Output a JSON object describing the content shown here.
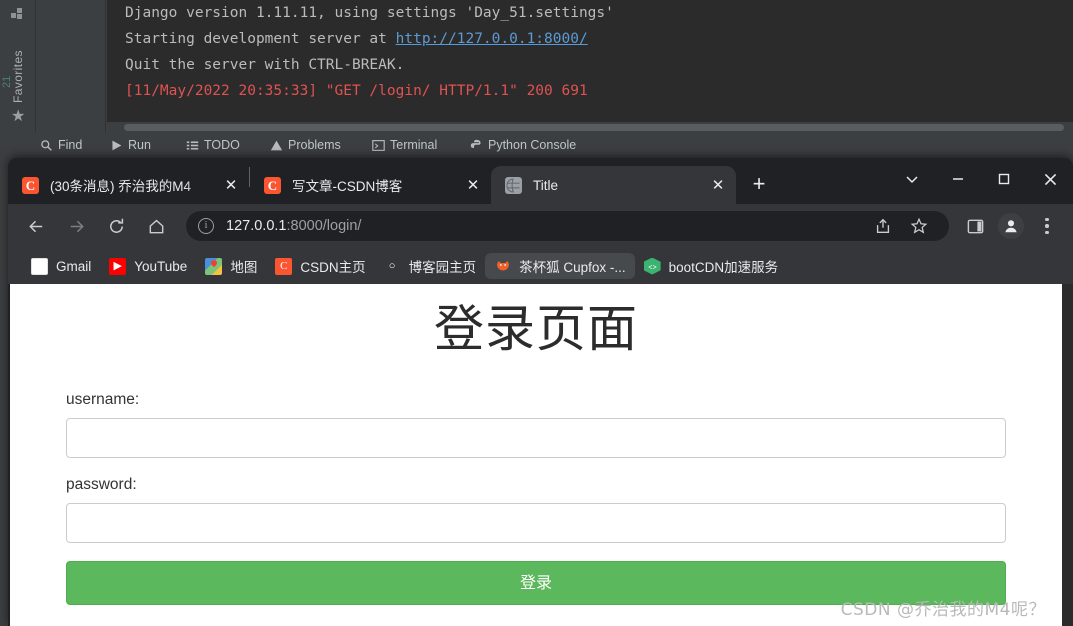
{
  "ide": {
    "sidebar": {
      "favorites_label": "Favorites",
      "star_icon": "star-icon",
      "gutter_number": "21"
    },
    "console_lines": [
      "Django version 1.11.11, using settings 'Day_51.settings'",
      "Starting development server at ",
      "Quit the server with CTRL-BREAK.",
      "[11/May/2022 20:35:33] \"GET /login/ HTTP/1.1\" 200 691"
    ],
    "console_link": "http://127.0.0.1:8000/",
    "toolwindows": [
      {
        "label": "Find",
        "icon": "search-icon"
      },
      {
        "label": "Run",
        "icon": "play-icon"
      },
      {
        "label": "TODO",
        "icon": "list-icon"
      },
      {
        "label": "Problems",
        "icon": "warning-icon"
      },
      {
        "label": "Terminal",
        "icon": "terminal-icon"
      },
      {
        "label": "Python Console",
        "icon": "python-icon"
      }
    ]
  },
  "browser": {
    "tabs": [
      {
        "title": "(30条消息) 乔治我的M4",
        "favicon": "csdn-icon",
        "favicon_text": "C",
        "active": false
      },
      {
        "title": "写文章-CSDN博客",
        "favicon": "csdn-icon",
        "favicon_text": "C",
        "active": false
      },
      {
        "title": "Title",
        "favicon": "globe-icon",
        "favicon_text": "⊕",
        "active": true
      }
    ],
    "tab_close_label": "✕",
    "new_tab_label": "+",
    "window_controls": [
      {
        "name": "tab-search-button",
        "glyph": "chevron-down-icon"
      },
      {
        "name": "minimize-button",
        "glyph": "minimize-icon"
      },
      {
        "name": "maximize-button",
        "glyph": "maximize-icon"
      },
      {
        "name": "close-window-button",
        "glyph": "close-icon"
      }
    ],
    "nav": {
      "back": "back-arrow-icon",
      "forward": "forward-arrow-icon",
      "reload": "reload-icon",
      "home": "home-icon"
    },
    "omnibox": {
      "info_glyph": "ⓘ",
      "url_host": "127.0.0.1",
      "url_path": ":8000/login/",
      "full_url": "127.0.0.1:8000/login/"
    },
    "toolbar_right": [
      {
        "name": "share-icon"
      },
      {
        "name": "bookmark-star-icon"
      },
      {
        "name": "side-panel-icon"
      },
      {
        "name": "profile-avatar"
      },
      {
        "name": "chrome-menu-icon"
      }
    ],
    "bookmarks": [
      {
        "label": "Gmail",
        "icon": "gmail-icon",
        "icon_text": "M",
        "icon_class": "ic-gmail",
        "hovered": false
      },
      {
        "label": "YouTube",
        "icon": "youtube-icon",
        "icon_text": "▶",
        "icon_class": "ic-yt",
        "hovered": false
      },
      {
        "label": "地图",
        "icon": "google-maps-icon",
        "icon_text": "",
        "icon_class": "ic-maps",
        "hovered": false
      },
      {
        "label": "CSDN主页",
        "icon": "csdn-icon",
        "icon_text": "C",
        "icon_class": "ic-csdn",
        "hovered": false
      },
      {
        "label": "博客园主页",
        "icon": "cnblogs-icon",
        "icon_text": "○",
        "icon_class": "ic-cnblogs",
        "hovered": false
      },
      {
        "label": "茶杯狐 Cupfox -...",
        "icon": "cupfox-fox-icon",
        "icon_text": "◔",
        "icon_class": "ic-cupfox",
        "hovered": true
      },
      {
        "label": "bootCDN加速服务",
        "icon": "bootcdn-icon",
        "icon_text": "‹›",
        "icon_class": "ic-bootcdn",
        "hovered": false
      }
    ]
  },
  "page": {
    "title": "登录页面",
    "username": {
      "label": "username:",
      "value": "",
      "placeholder": ""
    },
    "password": {
      "label": "password:",
      "value": "",
      "placeholder": ""
    },
    "submit_label": "登录",
    "watermark": "CSDN @乔治我的M4呢？",
    "colors": {
      "button_green": "#5cb85c",
      "button_border": "#4cae4c",
      "input_border": "#cccccc",
      "chrome_toolbar": "#35363a",
      "chrome_tabstrip": "#202124",
      "csdn_orange": "#fc5531"
    }
  }
}
